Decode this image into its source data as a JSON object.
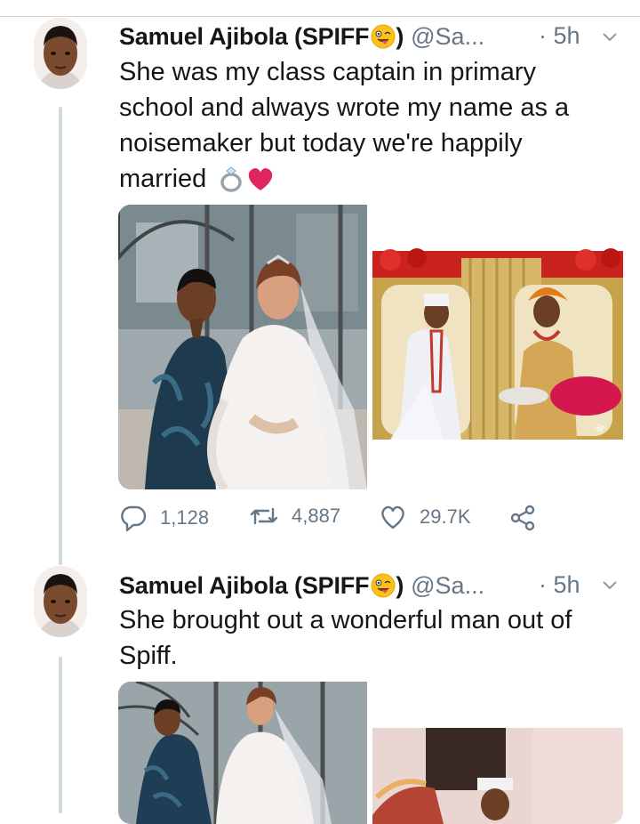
{
  "tweets": [
    {
      "display_name": "Samuel Ajibola (SPIFF",
      "display_name_close": ")",
      "handle": "@Sa...",
      "time": "· 5h",
      "text": "She was my class captain in primary school and always wrote my name as a noisemaker but today we're happily married",
      "text_emojis": [
        "ring-emoji",
        "heart-emoji"
      ],
      "replies": "1,128",
      "retweets": "4,887",
      "likes": "29.7K"
    },
    {
      "display_name": "Samuel Ajibola (SPIFF",
      "display_name_close": ")",
      "handle": "@Sa...",
      "time": "· 5h",
      "text": "She brought out a wonderful man out of Spiff."
    }
  ],
  "colors": {
    "text": "#14171a",
    "secondary": "#657786",
    "thread_line": "#cfd9de",
    "heart": "#e0245e"
  }
}
